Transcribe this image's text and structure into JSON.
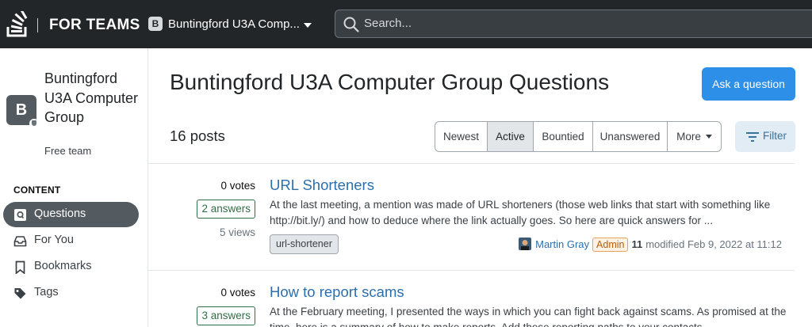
{
  "header": {
    "brand": "FOR TEAMS",
    "team_initial": "B",
    "team_name": "Buntingford U3A Comp...",
    "search_placeholder": "Search..."
  },
  "sidebar": {
    "team_initial": "B",
    "team_title": "Buntingford U3A Computer Group",
    "team_subtitle": "Free team",
    "section_heading": "CONTENT",
    "items": [
      {
        "label": "Questions",
        "icon": "questions-icon",
        "active": true
      },
      {
        "label": "For You",
        "icon": "inbox-icon",
        "active": false
      },
      {
        "label": "Bookmarks",
        "icon": "bookmark-icon",
        "active": false
      },
      {
        "label": "Tags",
        "icon": "tag-icon",
        "active": false
      }
    ]
  },
  "main": {
    "title": "Buntingford U3A Computer Group Questions",
    "ask_button": "Ask a question",
    "post_count": "16 posts",
    "tabs": [
      {
        "label": "Newest",
        "active": false
      },
      {
        "label": "Active",
        "active": true
      },
      {
        "label": "Bountied",
        "active": false
      },
      {
        "label": "Unanswered",
        "active": false
      },
      {
        "label": "More",
        "active": false
      }
    ],
    "filter_label": "Filter"
  },
  "questions": [
    {
      "votes": "0 votes",
      "answers": "2 answers",
      "views": "5 views",
      "title": "URL Shorteners",
      "excerpt": "At the last meeting, a mention was made of URL shorteners (those web links that start with something like http://bit.ly/) and how to deduce where the link actually goes. So here are quick answers for ...",
      "tag": "url-shortener",
      "user": "Martin Gray",
      "badge": "Admin",
      "rep": "11",
      "time": "modified Feb 9, 2022 at 11:12"
    },
    {
      "votes": "0 votes",
      "answers": "3 answers",
      "title": "How to report scams",
      "excerpt": "At the February meeting, I presented the ways in which you can fight back against scams. As promised at the time, here is a summary of how to make reports. Add these reporting paths to your contacts..."
    }
  ],
  "colors": {
    "topbar": "#232629",
    "accent": "#2e8fe8",
    "link": "#2c6fad",
    "answered": "#2f6f44"
  }
}
